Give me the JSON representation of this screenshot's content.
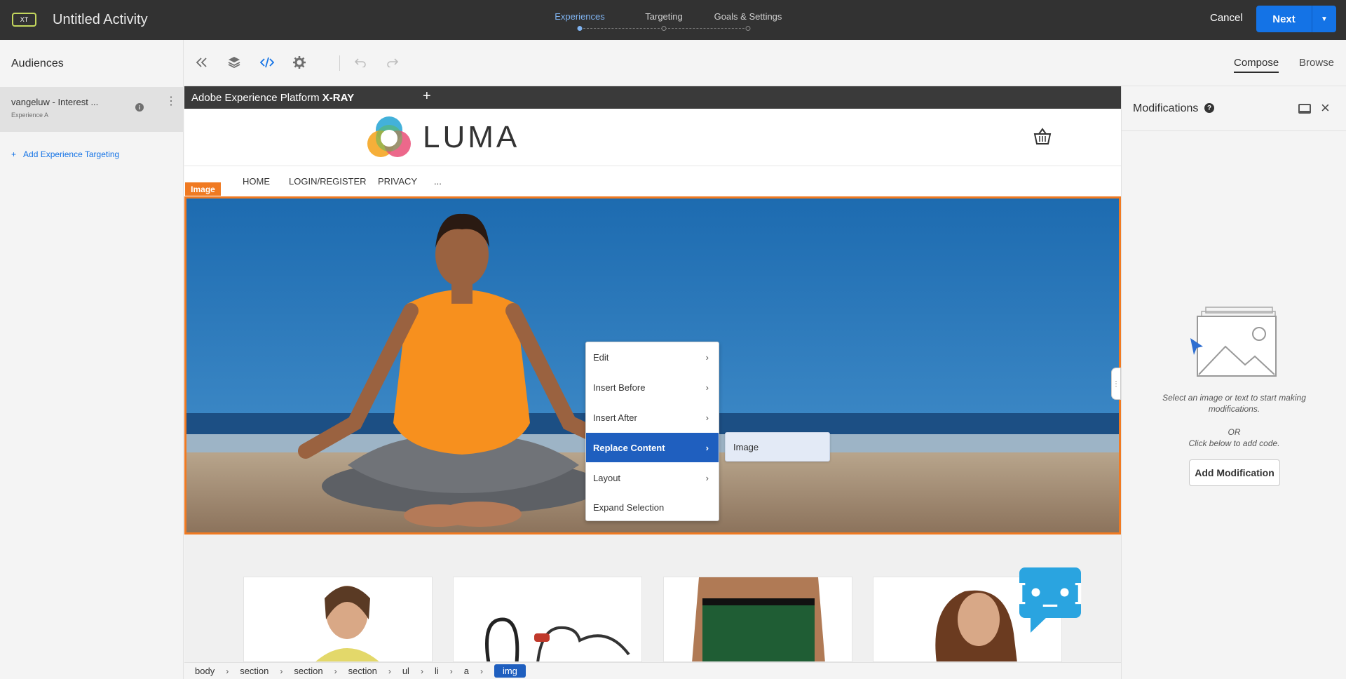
{
  "header": {
    "badge": "XT",
    "title": "Untitled Activity",
    "steps": [
      {
        "label": "Experiences",
        "active": true
      },
      {
        "label": "Targeting",
        "active": false
      },
      {
        "label": "Goals & Settings",
        "active": false
      }
    ],
    "cancel_label": "Cancel",
    "next_label": "Next"
  },
  "left_panel": {
    "title": "Audiences",
    "audience": {
      "name": "vangeluw - Interest ...",
      "experience": "Experience A"
    },
    "add_targeting_label": "Add Experience Targeting"
  },
  "toolbar": {
    "icons": [
      "collapse-left-icon",
      "layers-icon",
      "code-icon",
      "gear-icon",
      "undo-icon",
      "redo-icon"
    ],
    "compose_label": "Compose",
    "browse_label": "Browse"
  },
  "canvas": {
    "xray_title_prefix": "Adobe Experience Platform",
    "xray_title_bold": "X-RAY",
    "xray_plus": "+",
    "logo_text": "LUMA",
    "nav": [
      "HOME",
      "LOGIN/REGISTER",
      "PRIVACY",
      "..."
    ],
    "selected_tag": "Image"
  },
  "context_menu": {
    "items": [
      {
        "label": "Edit",
        "has_submenu": true
      },
      {
        "label": "Insert Before",
        "has_submenu": true
      },
      {
        "label": "Insert After",
        "has_submenu": true
      },
      {
        "label": "Replace Content",
        "has_submenu": true,
        "selected": true
      },
      {
        "label": "Layout",
        "has_submenu": true
      },
      {
        "label": "Expand Selection",
        "has_submenu": false
      }
    ],
    "submenu_item": "Image"
  },
  "breadcrumb": [
    "body",
    "section",
    "section",
    "section",
    "ul",
    "li",
    "a",
    "img"
  ],
  "right_panel": {
    "title": "Modifications",
    "help": "?",
    "message": "Select an image or text to start making modifications.",
    "or_text": "OR",
    "code_hint": "Click below to add code.",
    "add_button": "Add Modification"
  },
  "colors": {
    "accent": "#1473e6",
    "selection_orange": "#f07a22",
    "menu_selected": "#1f5fbf",
    "topbar": "#323232"
  }
}
